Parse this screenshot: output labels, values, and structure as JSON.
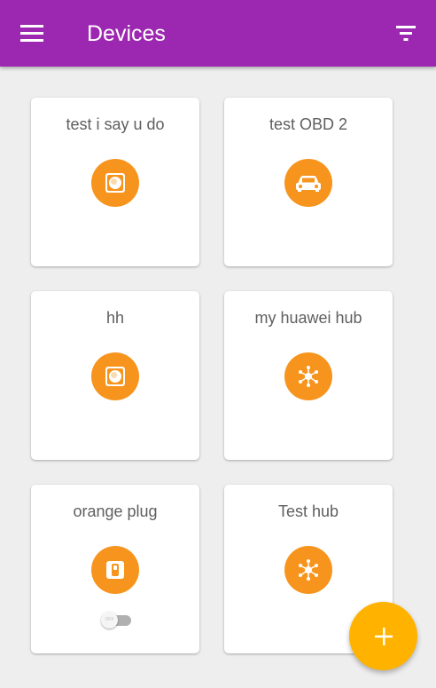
{
  "app": {
    "title": "Devices"
  },
  "header": {
    "menu_icon": "menu-icon",
    "filter_icon": "filter-icon"
  },
  "devices": [
    {
      "name": "test i say u do",
      "icon": "sensor-icon"
    },
    {
      "name": "test OBD 2",
      "icon": "car-icon"
    },
    {
      "name": "hh",
      "icon": "sensor-icon"
    },
    {
      "name": "my huawei hub",
      "icon": "hub-icon"
    },
    {
      "name": "orange plug",
      "icon": "plug-icon",
      "toggle_label": "OFF",
      "toggle_on": false
    },
    {
      "name": "Test hub",
      "icon": "hub-icon"
    }
  ],
  "fab": {
    "icon": "add-icon"
  },
  "colors": {
    "appbar": "#9c27b0",
    "device_icon_bg": "#f7941d",
    "fab": "#ffb300",
    "background": "#eeeeee"
  }
}
